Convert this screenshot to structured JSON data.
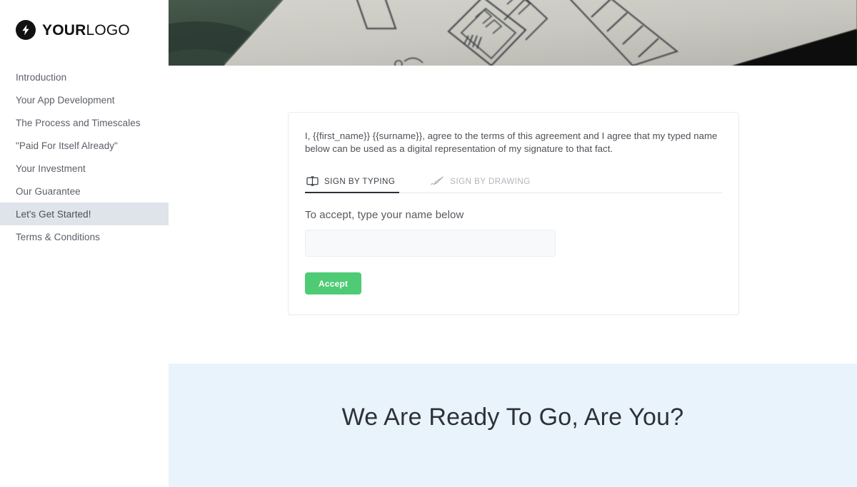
{
  "brand": {
    "logo_icon": "lightning-bolt-icon",
    "name_bold": "YOUR",
    "name_light": "LOGO",
    "logo_bg_color": "#111111"
  },
  "sidebar": {
    "items": [
      {
        "label": "Introduction",
        "active": false
      },
      {
        "label": "Your App Development",
        "active": false
      },
      {
        "label": "The Process and Timescales",
        "active": false
      },
      {
        "label": "\"Paid For Itself Already\"",
        "active": false
      },
      {
        "label": "Your Investment",
        "active": false
      },
      {
        "label": "Our Guarantee",
        "active": false
      },
      {
        "label": "Let's Get Started!",
        "active": true
      },
      {
        "label": "Terms & Conditions",
        "active": false
      }
    ],
    "active_bg_color": "#dfe3ea"
  },
  "hero": {
    "image_name": "wireframe-sketch-photo",
    "colors": {
      "paper": "#cfcec7",
      "dark_corner": "#0e1412",
      "green_edge": "#3d4f42"
    }
  },
  "card": {
    "agreement_text": "I, {{first_name}} {{surname}}, agree to the terms of this agreement and I agree that my typed name below can be used as a digital representation of my signature to that fact.",
    "tabs": [
      {
        "label": "SIGN BY TYPING",
        "icon": "text-cursor-icon",
        "active": true
      },
      {
        "label": "SIGN BY DRAWING",
        "icon": "pen-icon",
        "active": false
      }
    ],
    "form_label": "To accept, type your name below",
    "name_input": {
      "value": "",
      "placeholder": ""
    },
    "accept_label": "Accept",
    "accept_color": "#4ecb74"
  },
  "banner": {
    "title": "We Are Ready To Go, Are You?",
    "bg_color": "#e9f3fc"
  }
}
